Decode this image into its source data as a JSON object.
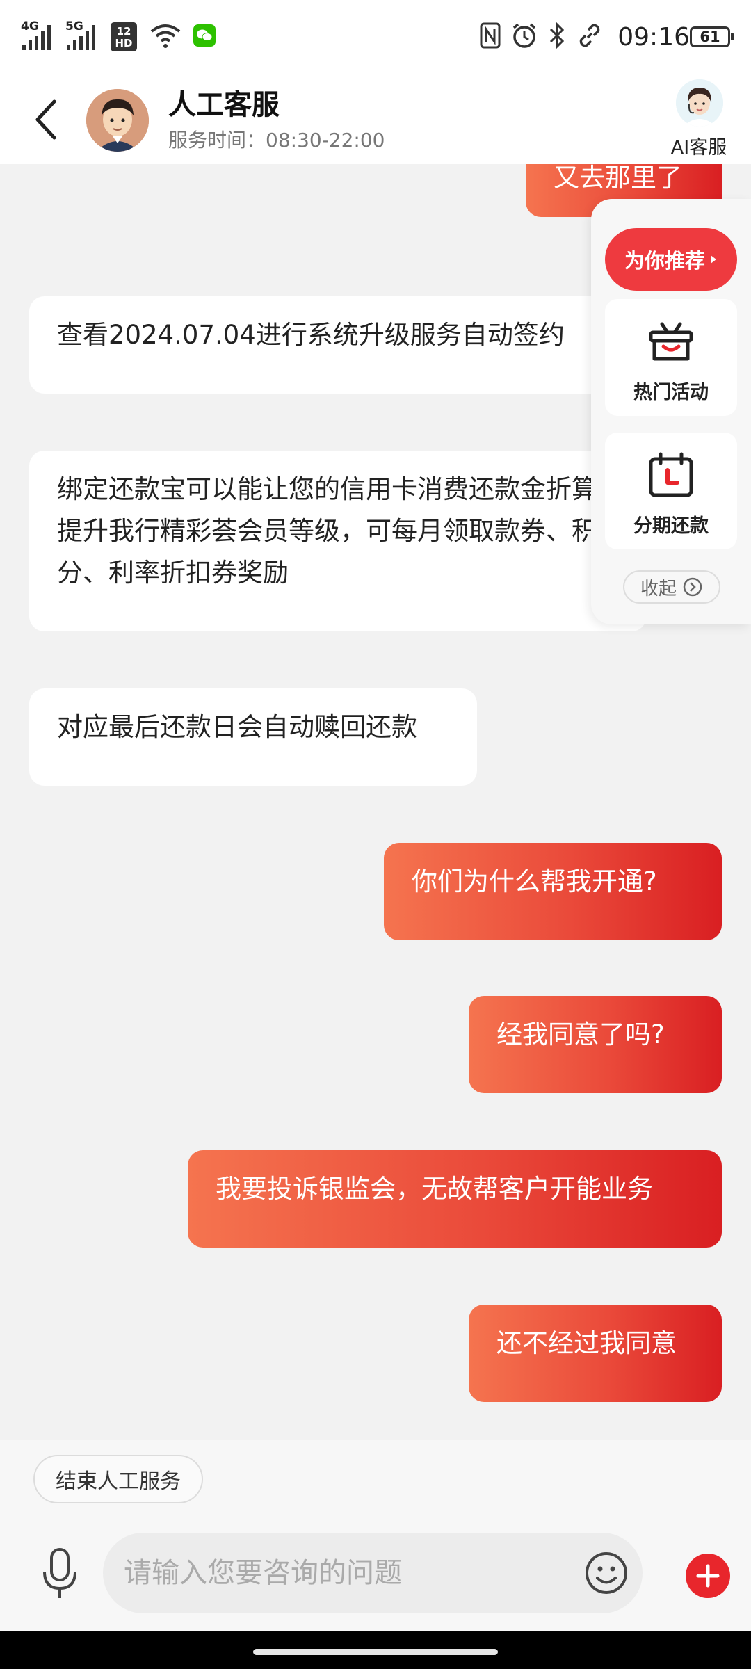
{
  "status_bar": {
    "network_1": "4G",
    "network_2": "5G",
    "hd_label": "HD",
    "time": "09:16",
    "battery": "61",
    "icons": [
      "signal-icon",
      "signal-icon",
      "hd-icon",
      "wifi-icon",
      "wechat-icon",
      "nfc-icon",
      "alarm-icon",
      "bluetooth-icon",
      "link-icon",
      "battery-icon"
    ]
  },
  "header": {
    "title": "人工客服",
    "service_hours": "服务时间：08:30-22:00",
    "ai_label": "AI客服"
  },
  "messages": [
    {
      "side": "right",
      "text": "又去那里了"
    },
    {
      "side": "left",
      "text": "查看2024.07.04进行系统升级服务自动签约"
    },
    {
      "side": "left",
      "text": "绑定还款宝可以能让您的信用卡消费还款金折算提升我行精彩荟会员等级，可每月领取款券、积分、利率折扣券奖励"
    },
    {
      "side": "left",
      "text": "对应最后还款日会自动赎回还款"
    },
    {
      "side": "right",
      "text": "你们为什么帮我开通?"
    },
    {
      "side": "right",
      "text": "经我同意了吗?"
    },
    {
      "side": "right",
      "text": "我要投诉银监会，无故帮客户开能业务"
    },
    {
      "side": "right",
      "text": "还不经过我同意"
    }
  ],
  "float_panel": {
    "recommend": "为你推荐",
    "hot_activity": "热门活动",
    "installment": "分期还款",
    "collapse": "收起"
  },
  "quick_actions": {
    "end_service": "结束人工服务"
  },
  "input": {
    "placeholder": "请输入您要咨询的问题"
  },
  "colors": {
    "accent": "#e8262c",
    "bubble_gradient_start": "#f5744f",
    "bubble_gradient_end": "#d91f22",
    "background": "#f2f2f2"
  }
}
